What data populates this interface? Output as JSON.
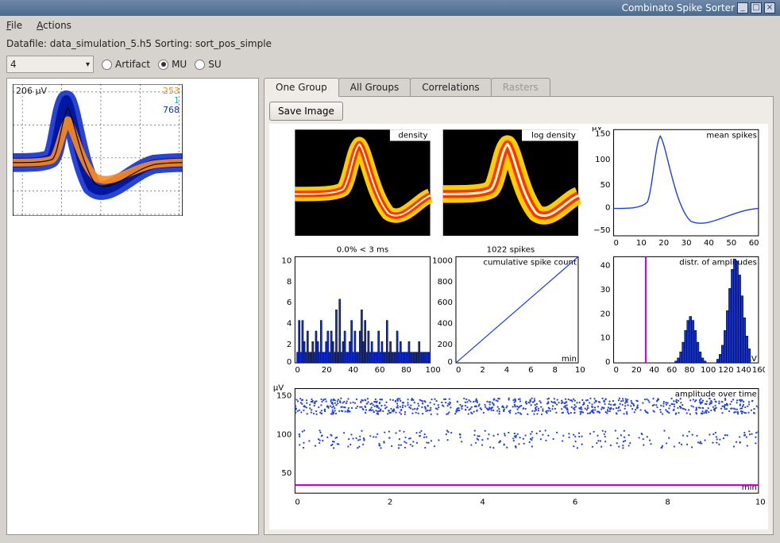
{
  "window": {
    "title": "Combinato Spike Sorter"
  },
  "menu": {
    "file": "File",
    "actions": "Actions"
  },
  "status": "Datafile: data_simulation_5.h5 Sorting: sort_pos_simple",
  "toolbar": {
    "combo_value": "4",
    "artifact": "Artifact",
    "mu": "MU",
    "su": "SU"
  },
  "tabs": {
    "one_group": "One Group",
    "all_groups": "All Groups",
    "correlations": "Correlations",
    "rasters": "Rasters"
  },
  "buttons": {
    "save_image": "Save Image"
  },
  "left_plot": {
    "uv_label": "206 µV",
    "counts": {
      "orange": "253",
      "cyan": "1",
      "blue": "768"
    }
  },
  "subplots": {
    "density": "density",
    "log_density": "log density",
    "mean_spikes": "mean spikes",
    "isi_title": "0.0% < 3 ms",
    "cum_title": "1022 spikes",
    "cum_label": "cumulative spike count",
    "amp_dist": "distr. of amplitudes",
    "amp_time": "amplitude over time",
    "uv": "µV",
    "min": "min"
  },
  "chart_data": [
    {
      "type": "line",
      "id": "waveform_left",
      "ylabel": "µV",
      "ylim": [
        -100,
        206
      ],
      "series": [
        {
          "name": "orange",
          "count": 253,
          "color": "#ff8c1a"
        },
        {
          "name": "cyan",
          "count": 1,
          "color": "#00b0f0"
        },
        {
          "name": "blue",
          "count": 768,
          "color": "#1030d0"
        }
      ],
      "note": "overlaid spike waveforms"
    },
    {
      "type": "heatmap",
      "id": "density",
      "title": "density"
    },
    {
      "type": "heatmap",
      "id": "log_density",
      "title": "log density"
    },
    {
      "type": "line",
      "id": "mean_spikes",
      "title": "mean spikes",
      "ylabel": "µV",
      "xlim": [
        0,
        64
      ],
      "ylim": [
        -50,
        150
      ],
      "xticks": [
        0,
        10,
        20,
        30,
        40,
        50,
        60
      ],
      "yticks": [
        -50,
        0,
        50,
        100,
        150
      ],
      "values_peak": 150
    },
    {
      "type": "bar",
      "id": "isi",
      "title": "0.0% < 3 ms",
      "xlim": [
        0,
        100
      ],
      "ylim": [
        0,
        10
      ],
      "xticks": [
        0,
        20,
        40,
        60,
        80,
        100
      ],
      "yticks": [
        0,
        2,
        4,
        6,
        8,
        10
      ]
    },
    {
      "type": "line",
      "id": "cumulative",
      "title": "1022 spikes",
      "subtitle": "cumulative spike count",
      "xlabel": "min",
      "xlim": [
        0,
        10
      ],
      "ylim": [
        0,
        1000
      ],
      "xticks": [
        0,
        2,
        4,
        6,
        8,
        10
      ],
      "yticks": [
        0,
        200,
        400,
        600,
        800,
        1000
      ]
    },
    {
      "type": "bar",
      "id": "amp_dist",
      "title": "distr. of amplitudes",
      "xlabel": "µV",
      "xlim": [
        0,
        160
      ],
      "ylim": [
        0,
        45
      ],
      "xticks": [
        0,
        20,
        40,
        60,
        80,
        100,
        120,
        140,
        160
      ],
      "yticks": [
        0,
        10,
        20,
        30,
        40
      ],
      "threshold_x": 35,
      "threshold_color": "#d000d0"
    },
    {
      "type": "scatter",
      "id": "amp_over_time",
      "title": "amplitude over time",
      "xlabel": "min",
      "ylabel": "µV",
      "xlim": [
        0,
        10
      ],
      "ylim": [
        30,
        160
      ],
      "xticks": [
        0,
        2,
        4,
        6,
        8,
        10
      ],
      "yticks": [
        50,
        100,
        150
      ],
      "threshold_y": 35,
      "threshold_color": "#d000d0"
    }
  ]
}
